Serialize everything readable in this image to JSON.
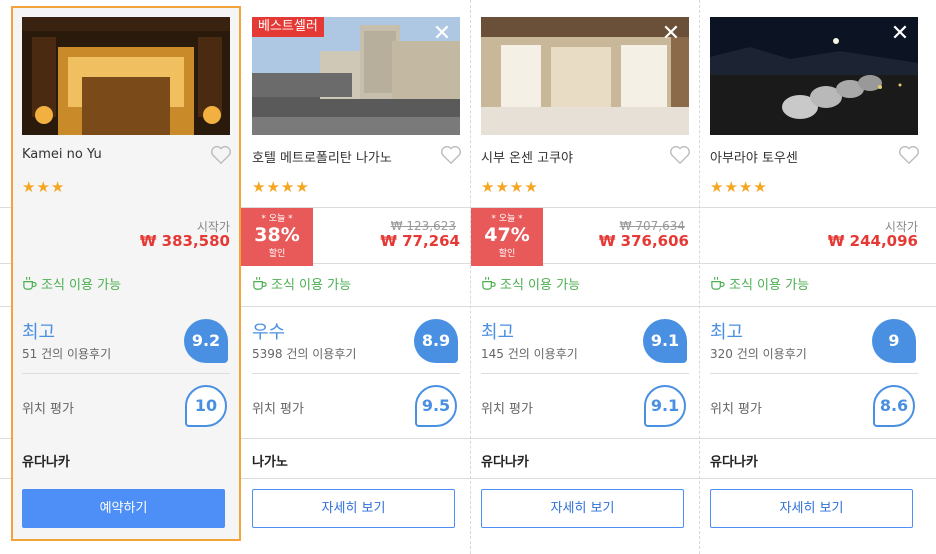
{
  "labels": {
    "from": "시작가",
    "breakfast": "조식 이용 가능",
    "location": "위치 평가",
    "today": "* 오늘 *",
    "off": "할인",
    "bestseller": "베스트셀러",
    "close": "✕",
    "star": "★"
  },
  "colors": {
    "accent": "#4a90e2",
    "price": "#e53935",
    "deal": "#e85a5a",
    "selected_border": "#f2a33a",
    "breakfast": "#4caf50",
    "star": "#f5a623"
  },
  "hotels": [
    {
      "name": "Kamei no Yu",
      "stars": "★★★",
      "price": "₩ 383,580",
      "rating_word": "최고",
      "reviews": "51 건의 이용후기",
      "score": "9.2",
      "location_score": "10",
      "region": "유다나카",
      "button": "예약하기"
    },
    {
      "name": "호텔 메트로폴리탄 나가노",
      "stars": "★★★★",
      "original_price": "₩ 123,623",
      "price": "₩ 77,264",
      "discount": "38%",
      "rating_word": "우수",
      "reviews": "5398 건의 이용후기",
      "score": "8.9",
      "location_score": "9.5",
      "region": "나가노",
      "button": "자세히 보기"
    },
    {
      "name": "시부 온센 고쿠야",
      "stars": "★★★★",
      "original_price": "₩ 707,634",
      "price": "₩ 376,606",
      "discount": "47%",
      "rating_word": "최고",
      "reviews": "145 건의 이용후기",
      "score": "9.1",
      "location_score": "9.1",
      "region": "유다나카",
      "button": "자세히 보기"
    },
    {
      "name": "아부라야 토우센",
      "stars": "★★★★",
      "price": "₩ 244,096",
      "rating_word": "최고",
      "reviews": "320 건의 이용후기",
      "score": "9",
      "location_score": "8.6",
      "region": "유다나카",
      "button": "자세히 보기"
    }
  ]
}
